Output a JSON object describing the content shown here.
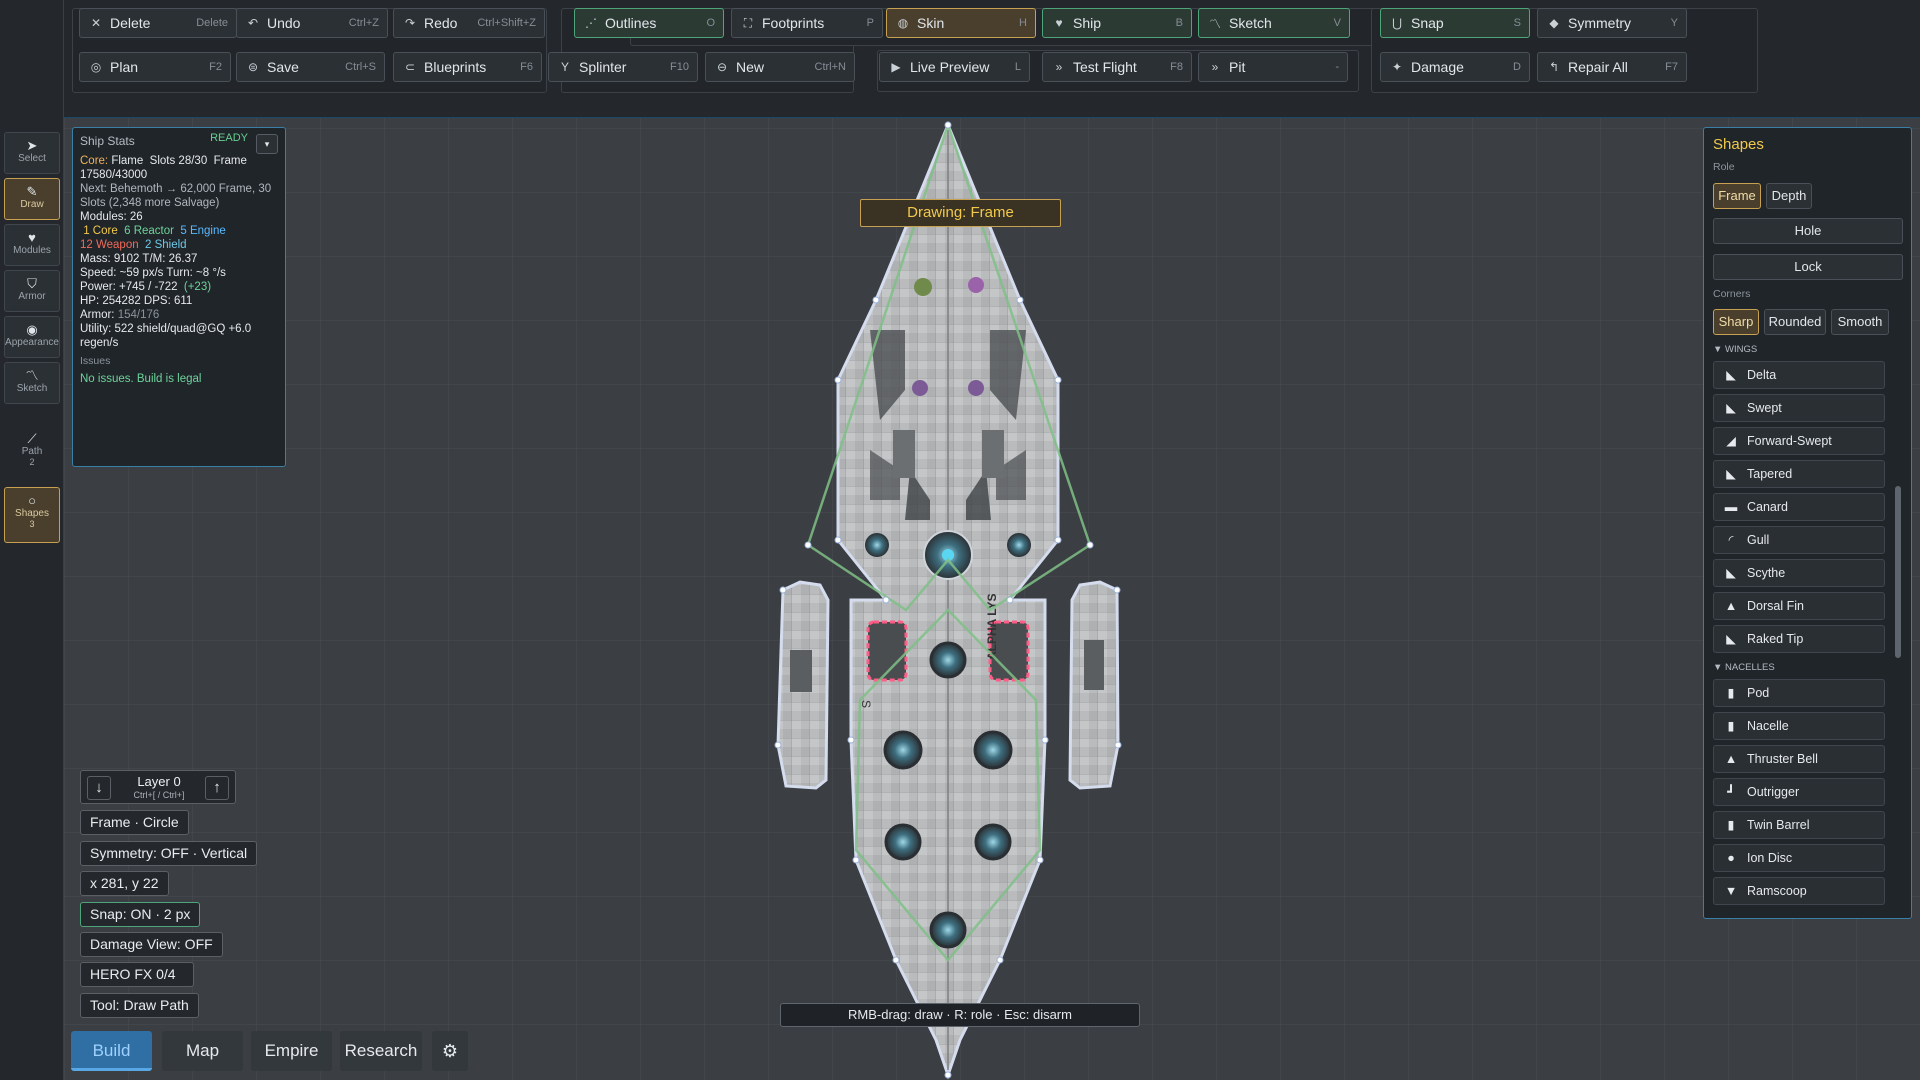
{
  "toolbar": {
    "row1": [
      {
        "label": "Delete",
        "shortcut": "Delete",
        "icon": "close-icon"
      },
      {
        "label": "Undo",
        "shortcut": "Ctrl+Z",
        "icon": "undo-icon"
      },
      {
        "label": "Redo",
        "shortcut": "Ctrl+Shift+Z",
        "icon": "redo-icon"
      },
      {
        "label": "Outlines",
        "shortcut": "O",
        "icon": "outline-icon"
      },
      {
        "label": "Footprints",
        "shortcut": "P",
        "icon": "footprint-icon"
      },
      {
        "label": "Skin",
        "shortcut": "H",
        "icon": "skin-icon"
      },
      {
        "label": "Ship",
        "shortcut": "B",
        "icon": "heart-icon"
      },
      {
        "label": "Sketch",
        "shortcut": "V",
        "icon": "sketch-icon"
      },
      {
        "label": "Snap",
        "shortcut": "S",
        "icon": "magnet-icon"
      },
      {
        "label": "Symmetry",
        "shortcut": "Y",
        "icon": "symmetry-icon"
      }
    ],
    "row2": [
      {
        "label": "Plan",
        "shortcut": "F2",
        "icon": "plan-icon"
      },
      {
        "label": "Save",
        "shortcut": "Ctrl+S",
        "icon": "save-icon"
      },
      {
        "label": "Blueprints",
        "shortcut": "F6",
        "icon": "blueprint-icon"
      },
      {
        "label": "Splinter",
        "shortcut": "F10",
        "icon": "splinter-icon"
      },
      {
        "label": "New",
        "shortcut": "Ctrl+N",
        "icon": "new-icon"
      },
      {
        "label": "Live Preview",
        "shortcut": "L",
        "icon": "play-icon"
      },
      {
        "label": "Test Flight",
        "shortcut": "F8",
        "icon": "flight-icon"
      },
      {
        "label": "Pit",
        "shortcut": "-",
        "icon": "pit-icon"
      },
      {
        "label": "Damage",
        "shortcut": "D",
        "icon": "damage-icon"
      },
      {
        "label": "Repair All",
        "shortcut": "F7",
        "icon": "wrench-icon"
      }
    ]
  },
  "tools": [
    {
      "label": "Select",
      "icon": "cursor-icon"
    },
    {
      "label": "Draw",
      "icon": "pencil-icon"
    },
    {
      "label": "Modules",
      "icon": "module-icon"
    },
    {
      "label": "Armor",
      "icon": "shield-icon"
    },
    {
      "label": "Appearance",
      "icon": "palette-icon"
    },
    {
      "label": "Sketch",
      "icon": "sketch-icon"
    },
    {
      "label": "Path",
      "sub": "2",
      "icon": "path-icon"
    },
    {
      "label": "Shapes",
      "sub": "3",
      "icon": "circle-icon"
    }
  ],
  "stats": {
    "title": "Ship Stats",
    "status": "READY",
    "core_label": "Core:",
    "core_value": "Flame",
    "slots": "Slots 28/30",
    "frame": "Frame",
    "frame_value": "17580/43000",
    "next": "Next: Behemoth → 62,000 Frame, 30 Slots (2,348 more Salvage)",
    "modules": "Modules: 26",
    "m_core": "1 Core",
    "m_reactor": "6 Reactor",
    "m_engine": "5 Engine",
    "m_weapon": "12 Weapon",
    "m_shield": "2 Shield",
    "mass": "Mass: 9102   T/M: 26.37",
    "speed": "Speed: ~59 px/s   Turn: ~8 °/s",
    "power": "Power: +745 / -722",
    "power_net": "(+23)",
    "hp": "HP: 254282   DPS: 611",
    "armor_label": "Armor:",
    "armor_value": "154/176",
    "utility": "Utility: 522 shield/quad@GQ  +6.0 regen/s",
    "issues_title": "Issues",
    "issues_text": "No issues. Build is legal"
  },
  "layer": {
    "label": "Layer 0",
    "keys": "Ctrl+[ / Ctrl+]"
  },
  "status_chips": [
    "Frame · Circle",
    "Symmetry: OFF · Vertical",
    "x 281, y 22",
    "Snap: ON · 2 px",
    "Damage View: OFF",
    "HERO FX 0/4",
    "Tool: Draw Path"
  ],
  "nav": [
    "Build",
    "Map",
    "Empire",
    "Research"
  ],
  "canvas": {
    "drawing_label": "Drawing: Frame",
    "hint": "RMB-drag: draw  ·  R: role  ·  Esc: disarm",
    "hull_text_left": "S",
    "hull_text_right": "ALPHA LYS"
  },
  "shapes": {
    "title": "Shapes",
    "role_label": "Role",
    "role_buttons": [
      "Frame",
      "Depth"
    ],
    "hole": "Hole",
    "lock": "Lock",
    "corners_label": "Corners",
    "corner_buttons": [
      "Sharp",
      "Rounded",
      "Smooth"
    ],
    "wings_label": "WINGS",
    "wings": [
      "Delta",
      "Swept",
      "Forward-Swept",
      "Tapered",
      "Canard",
      "Gull",
      "Scythe",
      "Dorsal Fin",
      "Raked Tip"
    ],
    "nacelles_label": "NACELLES",
    "nacelles": [
      "Pod",
      "Nacelle",
      "Thruster Bell",
      "Outrigger",
      "Twin Barrel",
      "Ion Disc",
      "Ramscoop"
    ]
  },
  "colors": {
    "accent": "#3a7fa5",
    "gold": "#c7a052",
    "green": "#4fa57a",
    "ready": "#66d08f"
  }
}
